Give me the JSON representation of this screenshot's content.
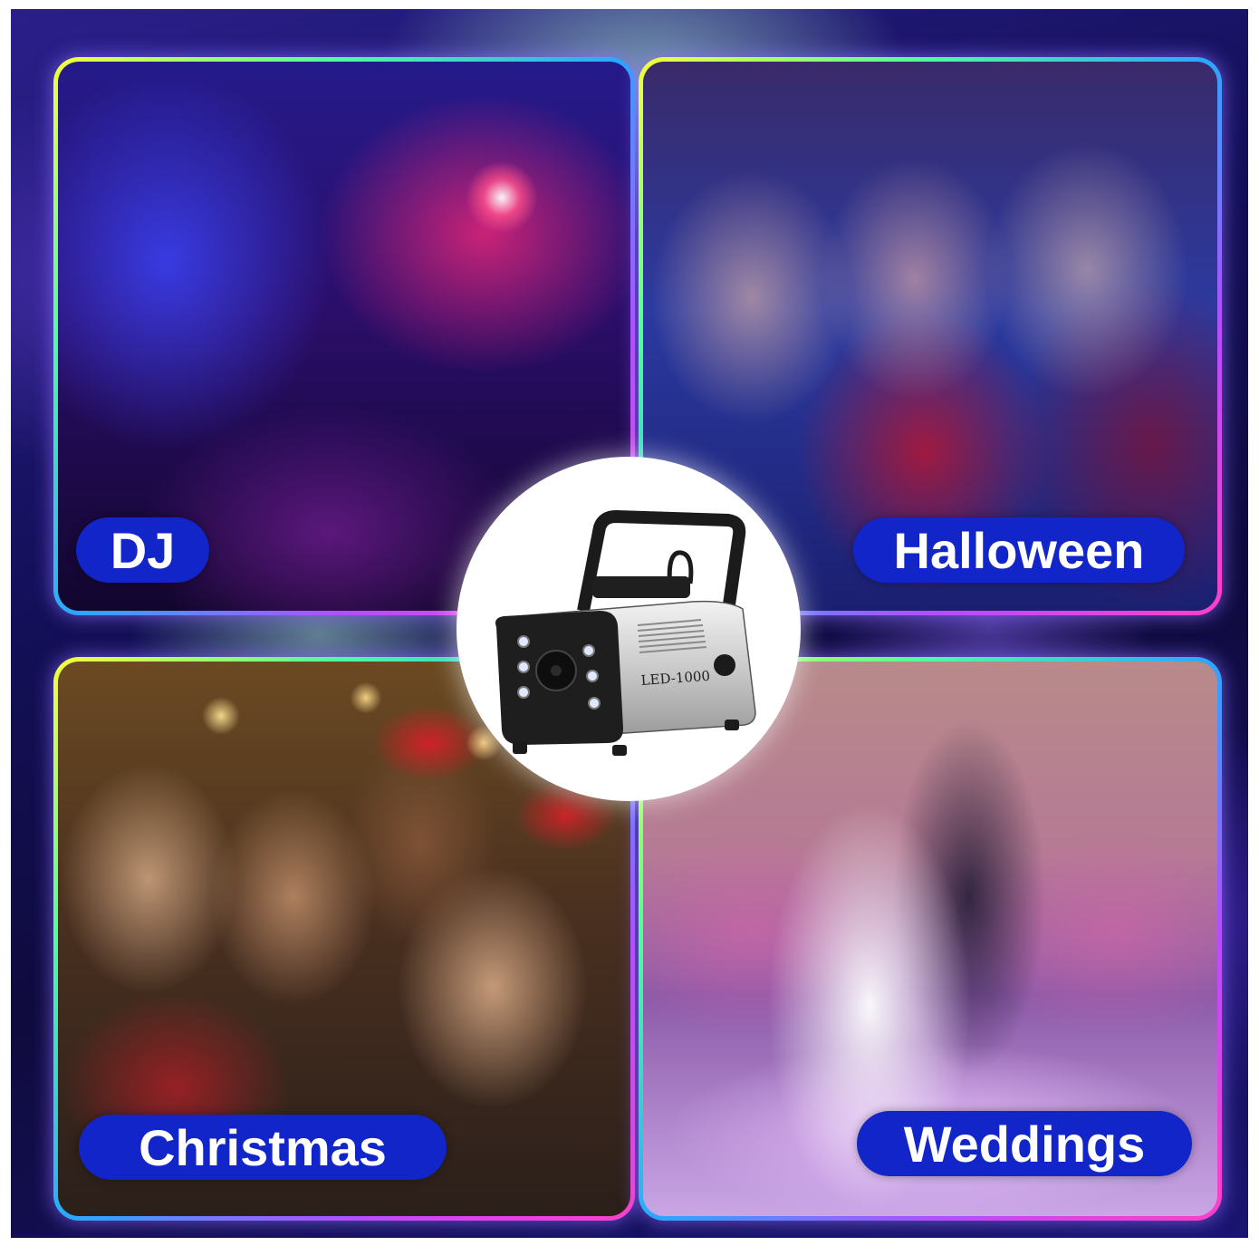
{
  "panels": {
    "dj": {
      "label": "DJ"
    },
    "halloween": {
      "label": "Halloween"
    },
    "christmas": {
      "label": "Christmas"
    },
    "weddings": {
      "label": "Weddings"
    }
  },
  "product": {
    "model_label": "LED-1000",
    "icon": "fog-machine-icon"
  },
  "colors": {
    "pill_background": "#1125c9",
    "pill_text": "#ffffff",
    "background": "#14105a"
  }
}
